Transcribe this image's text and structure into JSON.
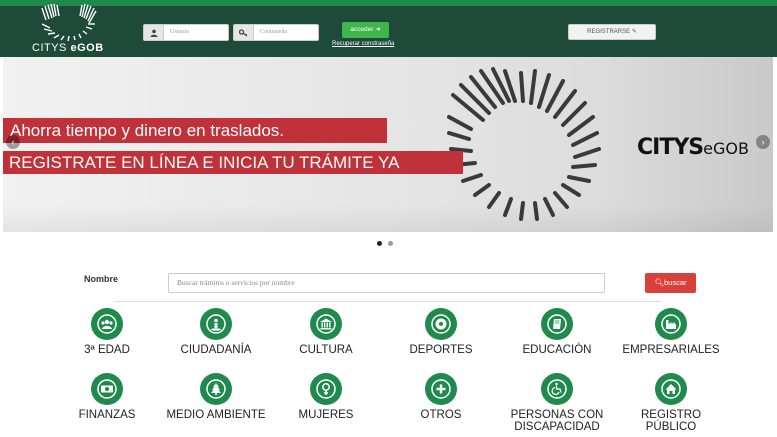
{
  "header": {
    "logo_text_1": "CITYS",
    "logo_text_2": "eGOB",
    "usuario_placeholder": "Usuario",
    "contrasena_placeholder": "Contraseña",
    "acceder_label": "acceder",
    "recuperar_label": "Recuperar constraseña",
    "registrarse_label": "REGISTRARSE"
  },
  "banner": {
    "line1": "Ahorra tiempo y dinero en traslados.",
    "line2": "REGISTRATE EN LÍNEA E INICIA TU TRÁMITE YA",
    "brand_bold": "CITYS",
    "brand_light": "eGOB"
  },
  "search": {
    "label": "Nombre",
    "placeholder": "Buscar trámites o servicios por nombre",
    "button_label": "buscar"
  },
  "categories": [
    {
      "label": "3ª EDAD",
      "icon": "group-icon"
    },
    {
      "label": "CIUDADANÍA",
      "icon": "person-pin-icon"
    },
    {
      "label": "CULTURA",
      "icon": "institution-icon"
    },
    {
      "label": "DEPORTES",
      "icon": "soccer-ball-icon"
    },
    {
      "label": "EDUCACIÓN",
      "icon": "book-icon"
    },
    {
      "label": "EMPRESARIALES",
      "icon": "industry-icon"
    },
    {
      "label": "FINANZAS",
      "icon": "money-icon"
    },
    {
      "label": "MEDIO AMBIENTE",
      "icon": "tree-icon"
    },
    {
      "label": "MUJERES",
      "icon": "venus-icon"
    },
    {
      "label": "OTROS",
      "icon": "plus-icon"
    },
    {
      "label": "PERSONAS CON DISCAPACIDAD",
      "icon": "wheelchair-icon"
    },
    {
      "label": "REGISTRO PÚBLICO",
      "icon": "home-icon"
    }
  ],
  "colors": {
    "brand_green": "#1f8a4c",
    "header_dark": "#1e4a3a",
    "accent_red": "#c0313a"
  }
}
